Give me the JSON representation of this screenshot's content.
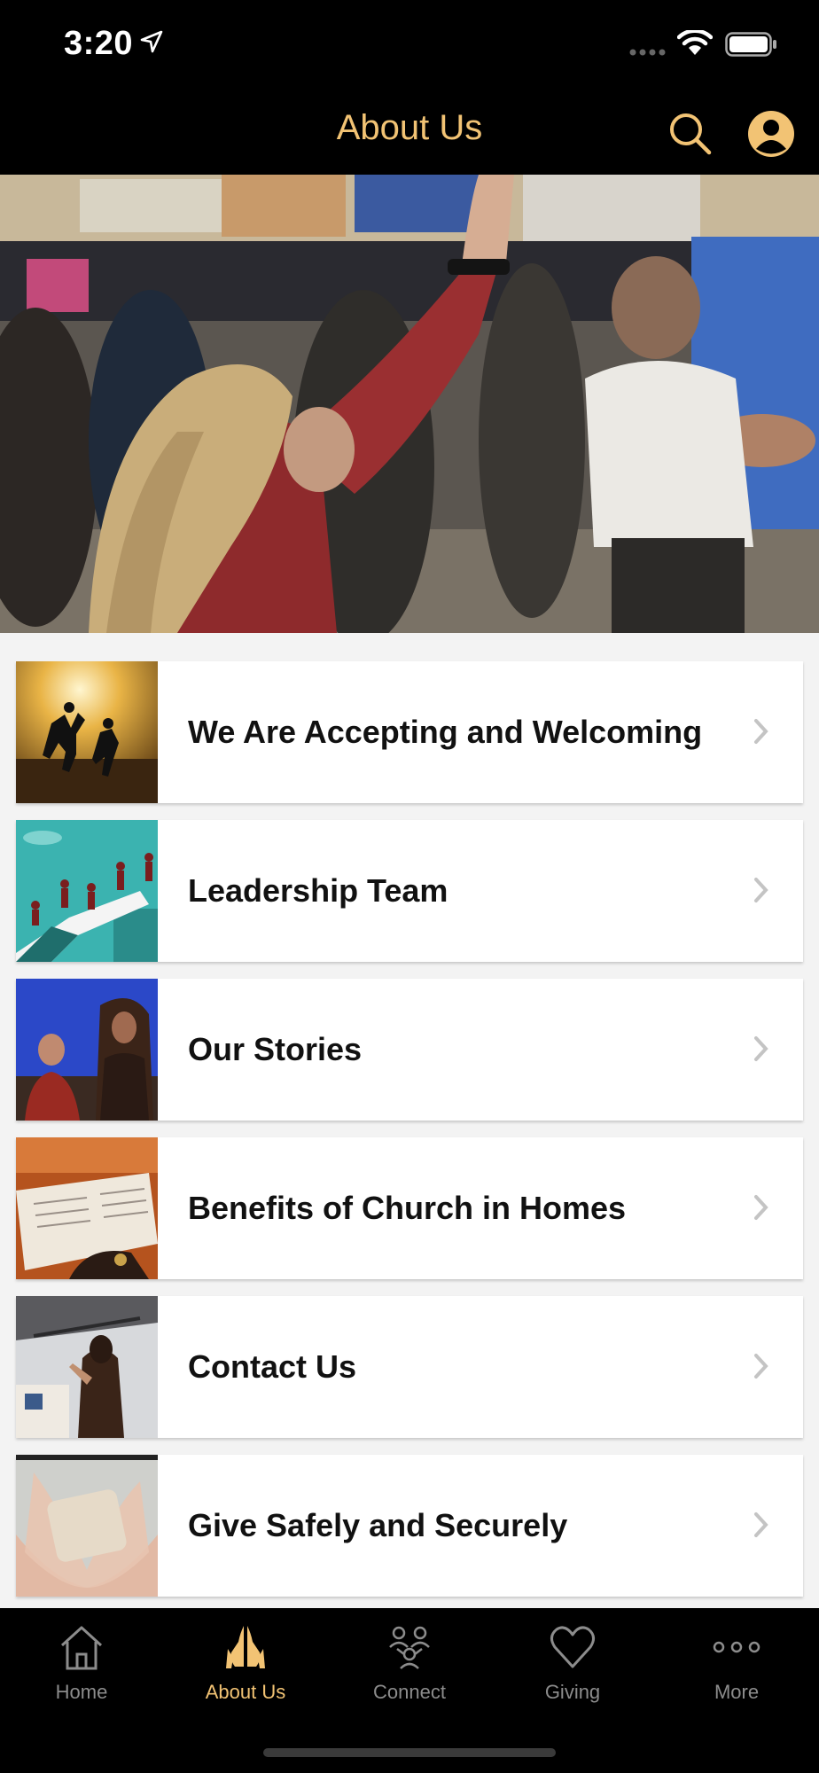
{
  "status_bar": {
    "time": "3:20"
  },
  "nav": {
    "title": "About Us"
  },
  "list": {
    "items": [
      {
        "label": "We Are Accepting and Welcoming",
        "thumb_icon": "beach-jump-photo"
      },
      {
        "label": "Leadership Team",
        "thumb_icon": "leadership-illustration"
      },
      {
        "label": "Our Stories",
        "thumb_icon": "stories-photo"
      },
      {
        "label": "Benefits of Church in Homes",
        "thumb_icon": "bible-photo"
      },
      {
        "label": "Contact Us",
        "thumb_icon": "contact-photo"
      },
      {
        "label": "Give Safely and Securely",
        "thumb_icon": "give-stone-photo"
      }
    ]
  },
  "tabs": [
    {
      "label": "Home",
      "icon": "house-icon",
      "active": false
    },
    {
      "label": "About Us",
      "icon": "praying-hands-icon",
      "active": true
    },
    {
      "label": "Connect",
      "icon": "people-icon",
      "active": false
    },
    {
      "label": "Giving",
      "icon": "heart-icon",
      "active": false
    },
    {
      "label": "More",
      "icon": "more-dots-icon",
      "active": false
    }
  ],
  "colors": {
    "accent": "#f2c374",
    "bar_bg": "#000000",
    "inactive": "#8c8c8c",
    "page_bg": "#f3f3f3"
  }
}
